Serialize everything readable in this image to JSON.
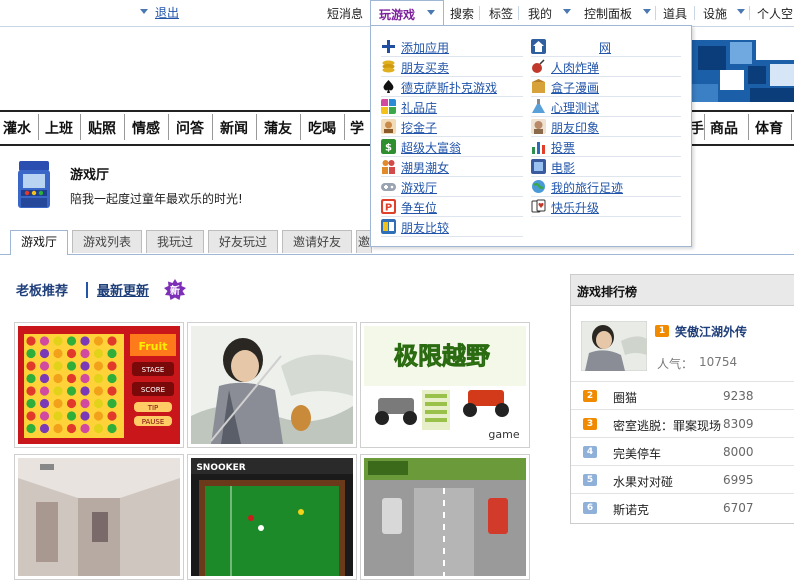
{
  "topbar": {
    "logout": "退出",
    "items": [
      "短消息",
      "玩游戏",
      "搜索",
      "标签",
      "我的",
      "控制面板",
      "道具",
      "设施",
      "个人空"
    ]
  },
  "categories": [
    "灌水",
    "上班",
    "贴照",
    "情感",
    "问答",
    "新闻",
    "蒲友",
    "吃喝",
    "学",
    "手",
    "商品",
    "体育"
  ],
  "menu": {
    "left": [
      {
        "label": "添加应用",
        "icon": "plus-icon",
        "color": "#1f4f9e"
      },
      {
        "label": "朋友买卖",
        "icon": "coins-icon",
        "color": "#e0b020"
      },
      {
        "label": "德克萨斯扑克游戏",
        "icon": "spade-icon",
        "color": "#111111"
      },
      {
        "label": "礼品店",
        "icon": "gift-grid-icon",
        "color": "#d24aa0"
      },
      {
        "label": "挖金子",
        "icon": "miner-icon",
        "color": "#c98a4a"
      },
      {
        "label": "超级大富翁",
        "icon": "money-icon",
        "color": "#2f8f2f"
      },
      {
        "label": "潮男潮女",
        "icon": "couple-icon",
        "color": "#e08a2a"
      },
      {
        "label": "游戏厅",
        "icon": "gamepad-icon",
        "color": "#9aa3b2"
      },
      {
        "label": "争车位",
        "icon": "parking-icon",
        "color": "#e0402a"
      },
      {
        "label": "朋友比较",
        "icon": "compare-icon",
        "color": "#2f6fb8"
      }
    ],
    "right": [
      {
        "label": "网",
        "icon": "home-icon",
        "color": "#2f5f9e"
      },
      {
        "label": "人肉炸弹",
        "icon": "bomb-icon",
        "color": "#c0392b"
      },
      {
        "label": "盒子漫画",
        "icon": "comic-icon",
        "color": "#d8a23a"
      },
      {
        "label": "心理测试",
        "icon": "flask-icon",
        "color": "#5aa0d8"
      },
      {
        "label": "朋友印象",
        "icon": "impression-icon",
        "color": "#b88a6a"
      },
      {
        "label": "投票",
        "icon": "bar-chart-icon",
        "color": "#2f8f4f"
      },
      {
        "label": "电影",
        "icon": "film-icon",
        "color": "#3a5aa0"
      },
      {
        "label": "我的旅行足迹",
        "icon": "globe-icon",
        "color": "#4a9ad8"
      },
      {
        "label": "快乐升级",
        "icon": "cards-icon",
        "color": "#333333"
      }
    ]
  },
  "hall": {
    "title": "游戏厅",
    "slogan": "陪我一起度过童年最欢乐的时光!"
  },
  "tabs": [
    "游戏厅",
    "游戏列表",
    "我玩过",
    "好友玩过",
    "邀请好友",
    "邀"
  ],
  "rec": {
    "boss": "老板推荐",
    "latest": "最新更新",
    "new_badge": "新"
  },
  "ranking": {
    "title": "游戏排行榜",
    "top": {
      "rank": "1",
      "name": "笑傲江湖外传",
      "popularity_label": "人气：",
      "popularity": "10754"
    },
    "rows": [
      {
        "rank": "2",
        "name": "圈猫",
        "score": "9238"
      },
      {
        "rank": "3",
        "name": "密室逃脱：罪案现场",
        "score": "8309"
      },
      {
        "rank": "4",
        "name": "完美停车",
        "score": "8000"
      },
      {
        "rank": "5",
        "name": "水果对对碰",
        "score": "6995"
      },
      {
        "rank": "6",
        "name": "斯诺克",
        "score": "6707"
      }
    ]
  },
  "thumbs": {
    "fruit": {
      "title": "Fruit",
      "stage": "STAGE",
      "score": "SCORE",
      "tip": "TIP",
      "pause": "PAUSE"
    },
    "offroad": {
      "title": "极限越野",
      "game": "game"
    },
    "snooker": {
      "title": "SNOOKER"
    }
  },
  "colors": {
    "link": "#2255aa",
    "accent_purple": "#7d1f9c",
    "rank_orange": "#f08a00",
    "rank_blue": "#8fb0d8"
  }
}
